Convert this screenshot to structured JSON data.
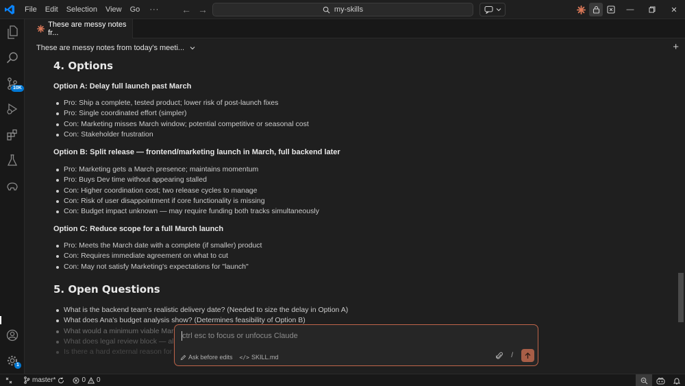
{
  "menu": {
    "items": [
      "File",
      "Edit",
      "Selection",
      "View",
      "Go"
    ],
    "more": "···"
  },
  "search": {
    "text": "my-skills"
  },
  "tab": {
    "label": "These are messy notes fr..."
  },
  "conversation": {
    "title": "These are messy notes from today's meeti..."
  },
  "document": {
    "section4": {
      "heading": "4. Options",
      "option_a": {
        "title": "Option A: Delay full launch past March",
        "items": [
          "Pro: Ship a complete, tested product; lower risk of post-launch fixes",
          "Pro: Single coordinated effort (simpler)",
          "Con: Marketing misses March window; potential competitive or seasonal cost",
          "Con: Stakeholder frustration"
        ]
      },
      "option_b": {
        "title": "Option B: Split release — frontend/marketing launch in March, full backend later",
        "items": [
          "Pro: Marketing gets a March presence; maintains momentum",
          "Pro: Buys Dev time without appearing stalled",
          "Con: Higher coordination cost; two release cycles to manage",
          "Con: Risk of user disappointment if core functionality is missing",
          "Con: Budget impact unknown — may require funding both tracks simultaneously"
        ]
      },
      "option_c": {
        "title": "Option C: Reduce scope for a full March launch",
        "items": [
          "Pro: Meets the March date with a complete (if smaller) product",
          "Con: Requires immediate agreement on what to cut",
          "Con: May not satisfy Marketing's expectations for \"launch\""
        ]
      }
    },
    "section5": {
      "heading": "5. Open Questions",
      "items": [
        "What is the backend team's realistic delivery date? (Needed to size the delay in Option A)",
        "What does Ana's budget analysis show? (Determines feasibility of Option B)",
        "What would a minimum viable March",
        "What does legal review block — all c",
        "Is there a hard external reason for M"
      ]
    }
  },
  "chat_input": {
    "placeholder": "ctrl esc to focus or unfocus Claude",
    "mode_label": "Ask before edits",
    "file_label": "SKILL.md",
    "slash": "/"
  },
  "activity": {
    "scm_badge": "10K",
    "settings_badge": "1"
  },
  "status": {
    "branch": "master*",
    "errors": "0",
    "warnings": "0"
  },
  "colors": {
    "accent": "#0078d4",
    "claude_orange": "#d97757",
    "send_button": "#a85e47"
  }
}
